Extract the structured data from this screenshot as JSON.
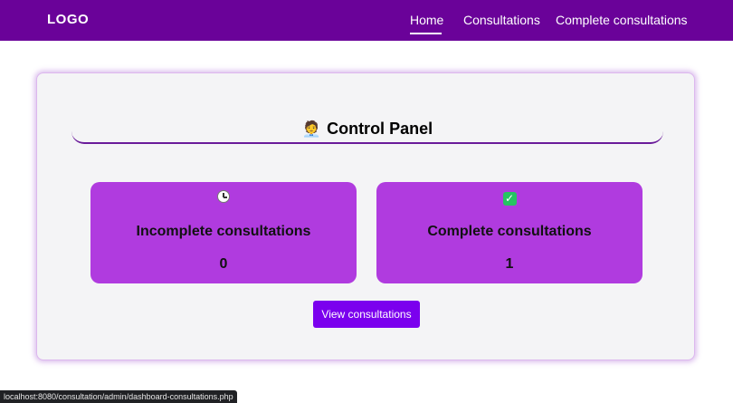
{
  "navbar": {
    "logo": "LOGO",
    "links": [
      {
        "label": "Home",
        "active": true
      },
      {
        "label": "Consultations",
        "active": false
      },
      {
        "label": "Complete consultations",
        "active": false
      }
    ]
  },
  "panel": {
    "title_icon": "🧑‍💼",
    "title": "Control Panel",
    "cards": [
      {
        "icon": "clock-icon",
        "label": "Incomplete consultations",
        "count": "0"
      },
      {
        "icon": "check-icon",
        "label": "Complete consultations",
        "count": "1"
      }
    ],
    "button_label": "View consultations"
  },
  "status_bar": {
    "url": "localhost:8080/consultation/admin/dashboard-consultations.php"
  },
  "colors": {
    "navbar_bg": "#6a0299",
    "card_bg": "#b03bdf",
    "button_bg": "#7b00ee",
    "panel_bg": "#f4f4f6"
  }
}
